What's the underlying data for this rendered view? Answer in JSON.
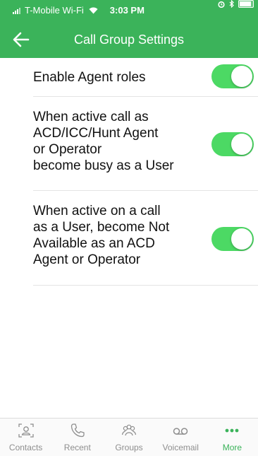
{
  "status_bar": {
    "carrier": "T-Mobile Wi-Fi",
    "time": "3:03 PM"
  },
  "header": {
    "title": "Call Group Settings"
  },
  "settings": [
    {
      "label": "Enable Agent roles",
      "enabled": true
    },
    {
      "label": "When active call as\nACD/ICC/Hunt Agent\nor Operator\nbecome busy as a User",
      "enabled": true
    },
    {
      "label": "When active on a call\nas a User, become Not\nAvailable as an ACD\nAgent or Operator",
      "enabled": true
    }
  ],
  "tabs": [
    {
      "label": "Contacts",
      "icon": "contacts-icon",
      "active": false
    },
    {
      "label": "Recent",
      "icon": "phone-icon",
      "active": false
    },
    {
      "label": "Groups",
      "icon": "groups-icon",
      "active": false
    },
    {
      "label": "Voicemail",
      "icon": "voicemail-icon",
      "active": false
    },
    {
      "label": "More",
      "icon": "more-icon",
      "active": true
    }
  ],
  "colors": {
    "header_green": "#3bb35a",
    "toggle_on": "#4cd964",
    "tab_inactive": "#8e8e8e",
    "tab_active": "#3bb35a"
  }
}
